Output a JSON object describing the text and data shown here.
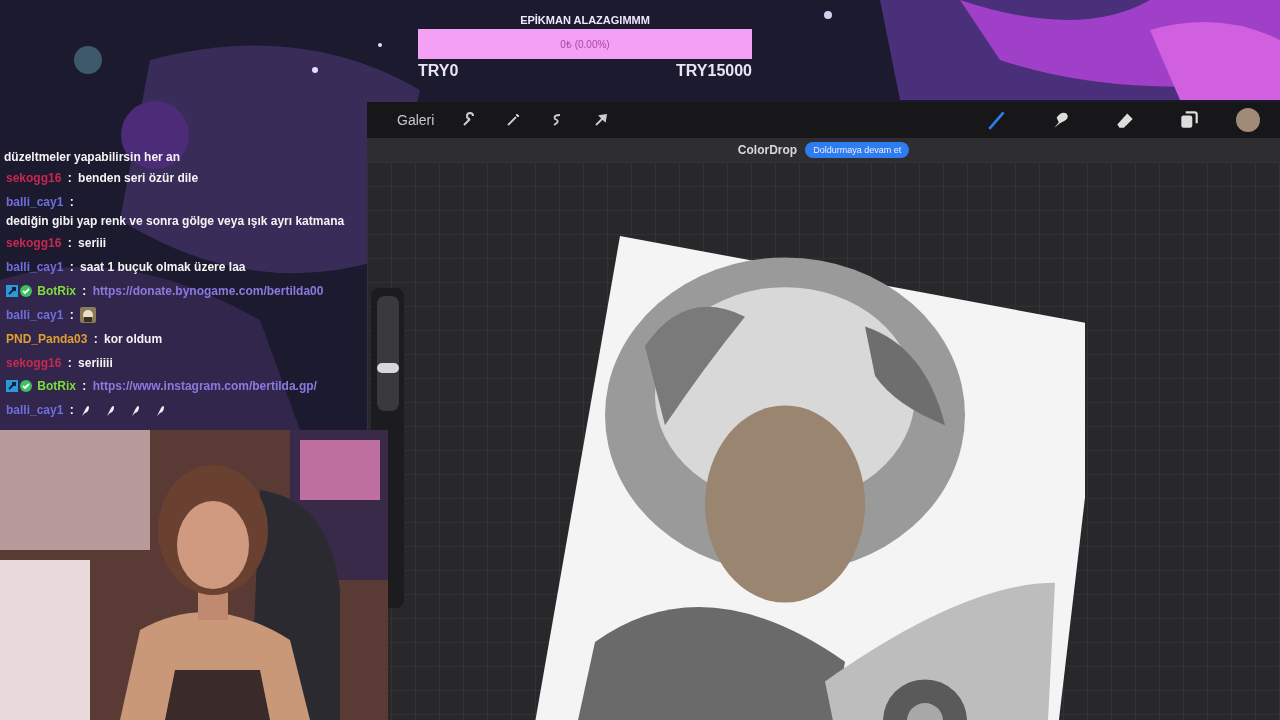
{
  "goal": {
    "title": "EPİKMAN ALAZAGIMMM",
    "reading": "0₺ (0.00%)",
    "level": 0,
    "min": "TRY0",
    "max": "TRY15000"
  },
  "chat": [
    {
      "kind": "continuation",
      "text": "düzeltmeler yapabilirsin her an"
    },
    {
      "kind": "text",
      "user": "sekogg16",
      "color": "#c8284f",
      "badged": false,
      "separator": ":",
      "text": "benden seri özür dile"
    },
    {
      "kind": "text",
      "user": "balli_cay1",
      "color": "#6e6edc",
      "badged": false,
      "separator": ":",
      "text": "dediğin gibi yap renk ve sonra gölge veya ışık ayrı katmana"
    },
    {
      "kind": "text",
      "user": "sekogg16",
      "color": "#c8284f",
      "badged": false,
      "separator": ":",
      "text": "seriii"
    },
    {
      "kind": "text",
      "user": "balli_cay1",
      "color": "#6e6edc",
      "badged": false,
      "separator": ":",
      "text": "saat 1 buçuk olmak üzere laa"
    },
    {
      "kind": "link",
      "user": "BotRix",
      "color": "#7ddc3c",
      "badged": true,
      "separator": ":",
      "text": "https://donate.bynogame.com/bertilda00"
    },
    {
      "kind": "emote",
      "user": "balli_cay1",
      "color": "#6e6edc",
      "badged": false,
      "separator": ":"
    },
    {
      "kind": "text",
      "user": "PND_Panda03",
      "color": "#e0a030",
      "badged": false,
      "separator": ":",
      "text": "kor oldum"
    },
    {
      "kind": "text",
      "user": "sekogg16",
      "color": "#c8284f",
      "badged": false,
      "separator": ":",
      "text": "seriiiii"
    },
    {
      "kind": "link",
      "user": "BotRix",
      "color": "#7ddc3c",
      "badged": true,
      "separator": ":",
      "text": "https://www.instagram.com/bertilda.gp/"
    },
    {
      "kind": "feathers",
      "user": "balli_cay1",
      "color": "#6e6edc",
      "badged": false,
      "separator": ":"
    }
  ],
  "app": {
    "gallery": "Galeri",
    "left_tools": [
      {
        "kind": "wrench"
      },
      {
        "kind": "wand"
      },
      {
        "kind": "s-curve"
      },
      {
        "kind": "arrow"
      }
    ],
    "right_tools": [
      {
        "kind": "brush",
        "selected": true
      },
      {
        "kind": "smudge",
        "selected": false
      },
      {
        "kind": "eraser",
        "selected": false
      },
      {
        "kind": "layers",
        "selected": false
      }
    ],
    "colordrop": {
      "label": "ColorDrop",
      "button": "Doldurmaya devam et"
    },
    "brush_size": {
      "level": 0.36
    }
  }
}
